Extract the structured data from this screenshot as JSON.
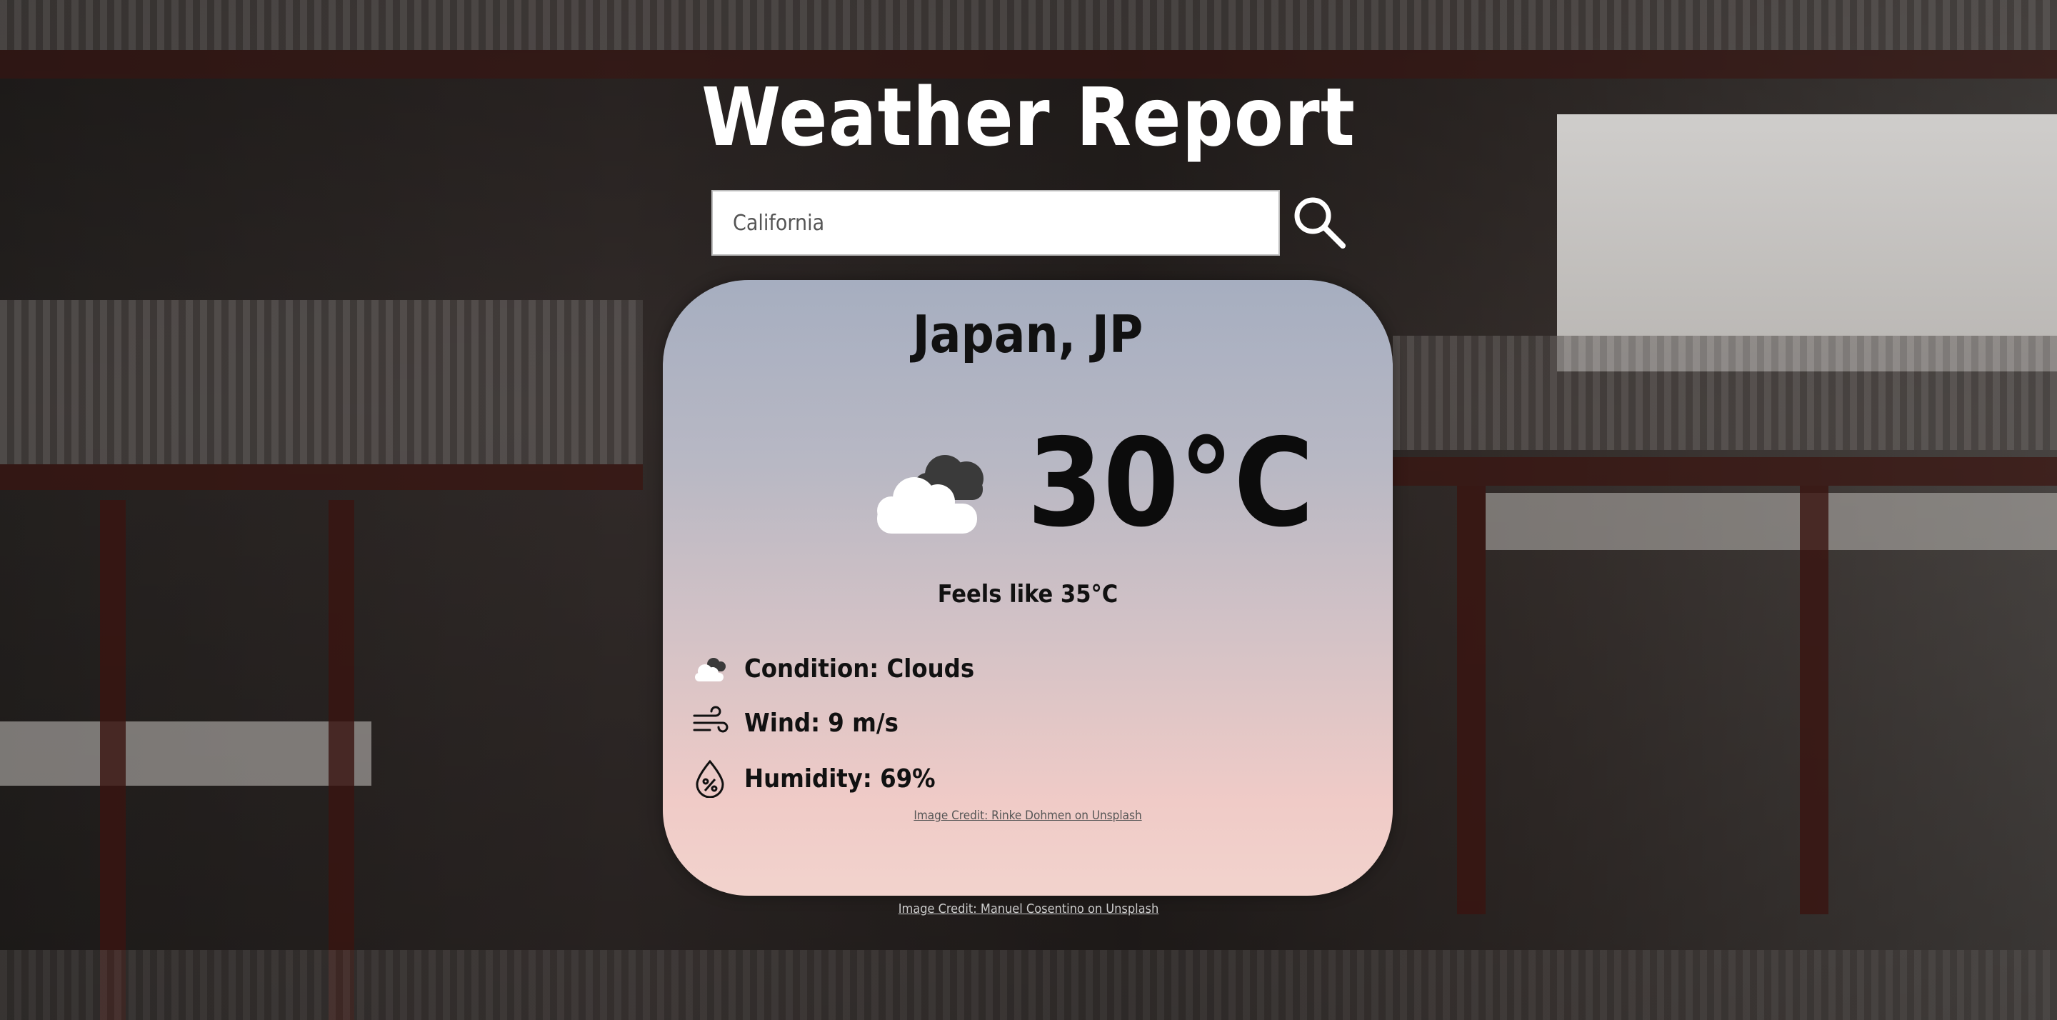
{
  "header": {
    "title": "Weather Report"
  },
  "search": {
    "value": "California",
    "icon": "search-icon"
  },
  "weather": {
    "location": "Japan, JP",
    "temperature": "30°C",
    "feels_like": "Feels like 35°C",
    "condition_icon": "clouds-icon",
    "details": {
      "condition": "Condition: Clouds",
      "wind": "Wind: 9 m/s",
      "humidity": "Humidity: 69%"
    },
    "card_credit": "Image Credit: Rinke Dohmen on Unsplash"
  },
  "page_credit": "Image Credit: Manuel Cosentino on Unsplash"
}
